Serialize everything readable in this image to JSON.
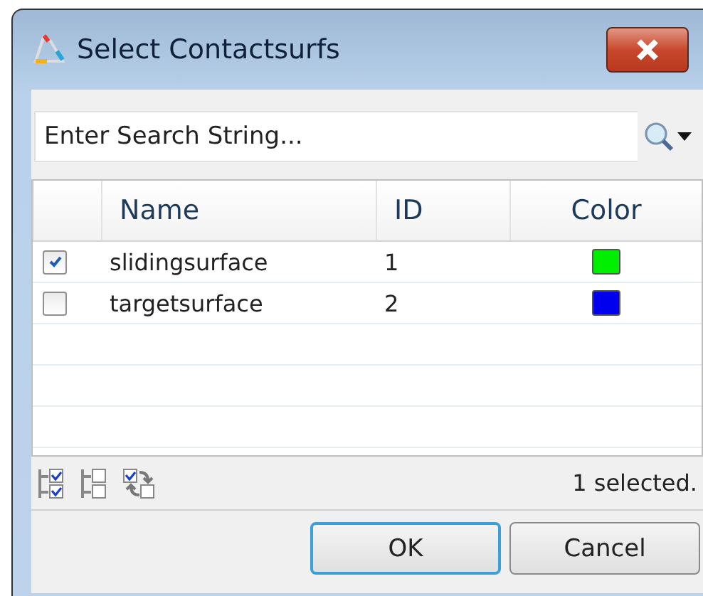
{
  "window": {
    "title": "Select Contactsurfs"
  },
  "search": {
    "placeholder": "Enter Search String..."
  },
  "table": {
    "columns": [
      "Name",
      "ID",
      "Color"
    ],
    "rows": [
      {
        "checked": true,
        "name": "slidingsurface",
        "id": "1",
        "color": "#00ee00"
      },
      {
        "checked": false,
        "name": "targetsurface",
        "id": "2",
        "color": "#0000ee"
      }
    ]
  },
  "status": "1 selected.",
  "buttons": [
    {
      "label": "OK",
      "kind": "default"
    },
    {
      "label": "Cancel",
      "kind": "normal"
    }
  ]
}
